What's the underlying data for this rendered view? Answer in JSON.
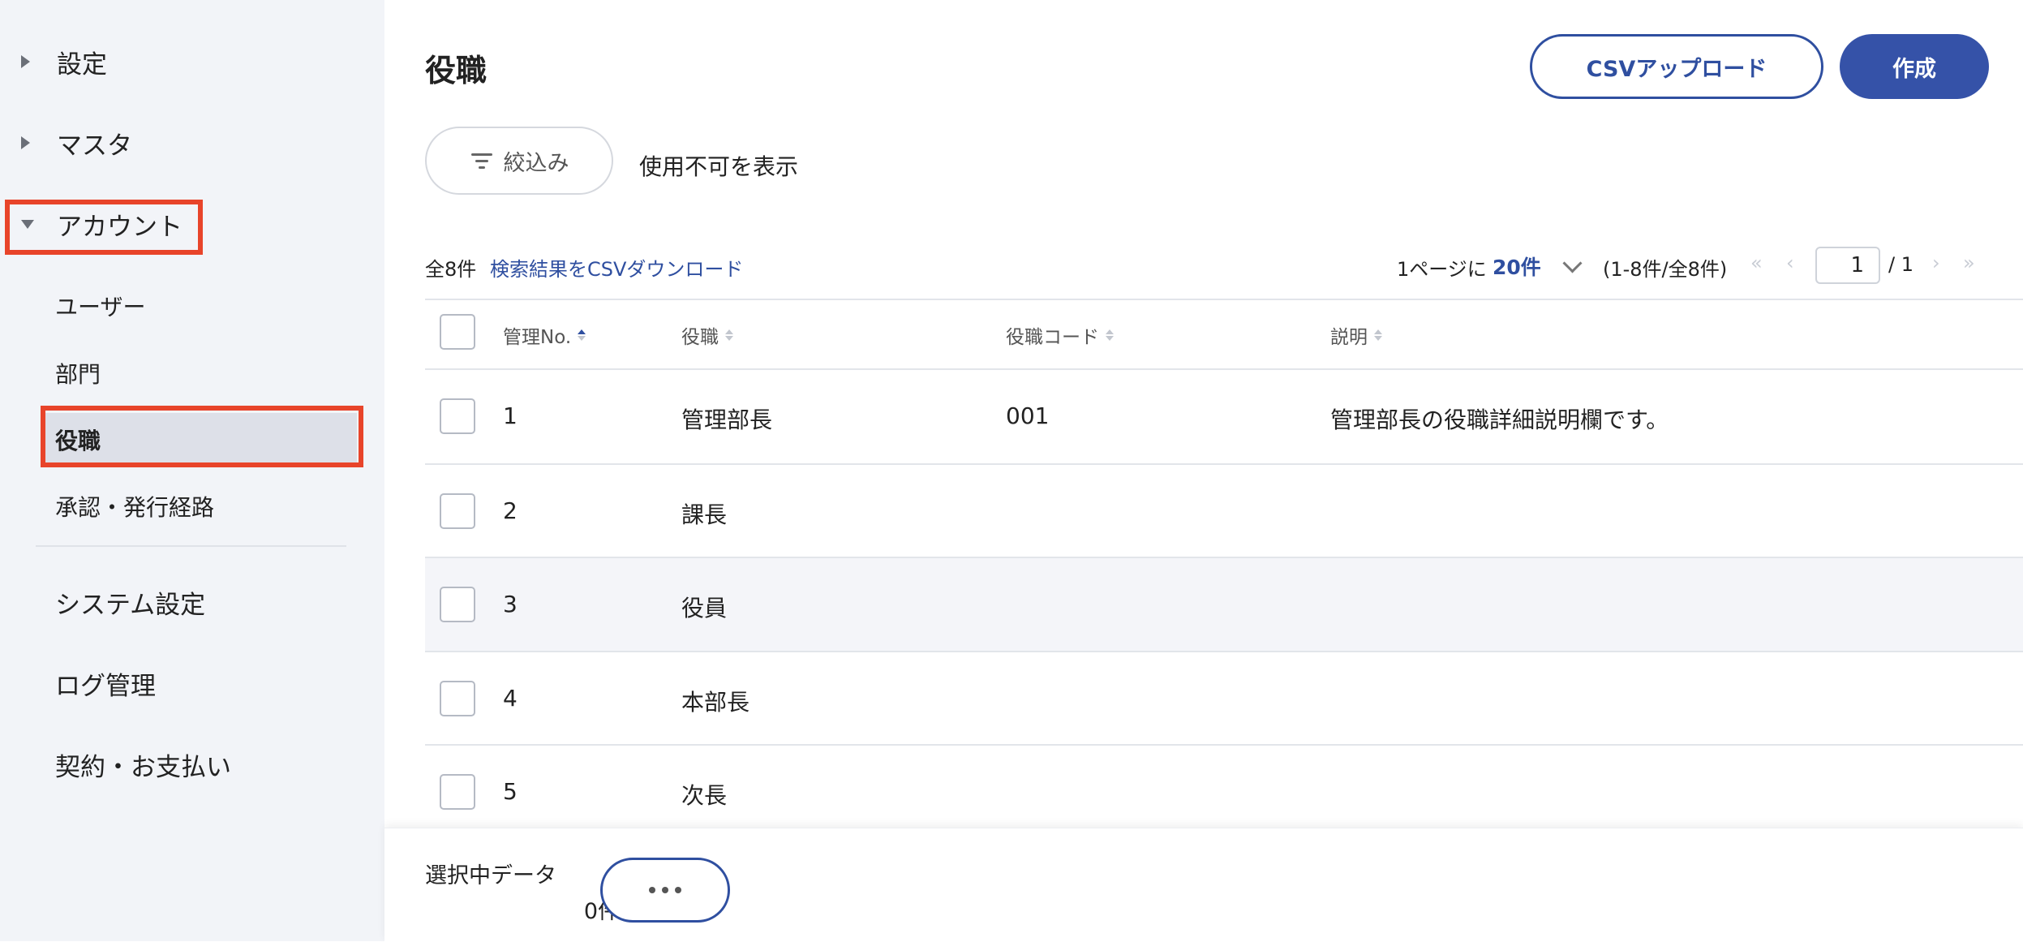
{
  "sidebar": {
    "groups": [
      {
        "label": "設定"
      },
      {
        "label": "マスタ"
      },
      {
        "label": "アカウント"
      }
    ],
    "account_items": [
      {
        "label": "ユーザー"
      },
      {
        "label": "部門"
      },
      {
        "label": "役職"
      },
      {
        "label": "承認・発行経路"
      }
    ],
    "bottom_items": [
      {
        "label": "システム設定"
      },
      {
        "label": "ログ管理"
      },
      {
        "label": "契約・お支払い"
      }
    ]
  },
  "header": {
    "title": "役職",
    "csv_upload_label": "CSVアップロード",
    "create_label": "作成"
  },
  "toolbar": {
    "filter_label": "絞込み",
    "show_disabled_label": "使用不可を表示"
  },
  "summary": {
    "count": "全8件",
    "csv_download": "検索結果をCSVダウンロード",
    "per_page_prefix": "1ページに",
    "per_page_value": "20件",
    "range": "(1-8件/全8件)",
    "current_page": "1",
    "total_pages": "/ 1"
  },
  "table": {
    "columns": [
      "管理No.",
      "役職",
      "役職コード",
      "説明"
    ],
    "rows": [
      {
        "no": "1",
        "title": "管理部長",
        "code": "001",
        "desc": "管理部長の役職詳細説明欄です。"
      },
      {
        "no": "2",
        "title": "課長",
        "code": "",
        "desc": ""
      },
      {
        "no": "3",
        "title": "役員",
        "code": "",
        "desc": ""
      },
      {
        "no": "4",
        "title": "本部長",
        "code": "",
        "desc": ""
      },
      {
        "no": "5",
        "title": "次長",
        "code": "",
        "desc": ""
      }
    ]
  },
  "footer": {
    "selected_label": "選択中データ",
    "selected_count": "0件"
  },
  "colors": {
    "accent": "#2f4fa0",
    "highlight": "#e8442a",
    "sidebar_bg": "#f2f4f8"
  }
}
